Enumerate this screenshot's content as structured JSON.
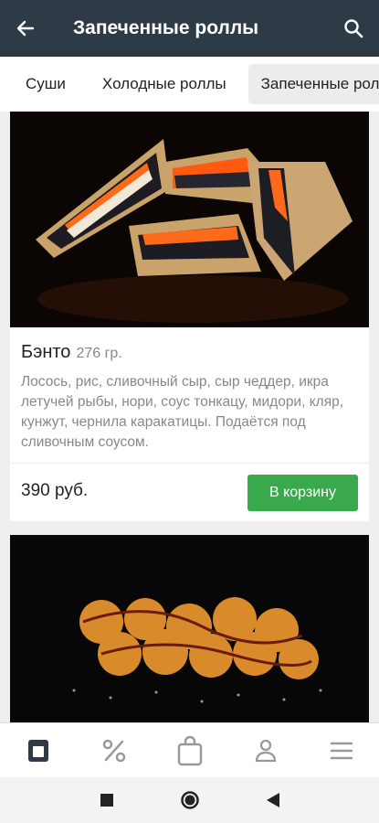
{
  "header": {
    "title": "Запеченные роллы",
    "back_icon": "arrow-left-icon",
    "search_icon": "search-icon"
  },
  "tabs": [
    {
      "label": "Суши",
      "active": false
    },
    {
      "label": "Холодные роллы",
      "active": false
    },
    {
      "label": "Запеченные роллы",
      "active": true
    }
  ],
  "products": [
    {
      "name": "Бэнто",
      "weight": "276 гр.",
      "description": "Лосось, рис, сливочный сыр, сыр чеддер, икра летучей рыбы, нори, соус тонкацу, мидори, кляр, кунжут, чернила каракатицы. Подаётся под сливочным соусом.",
      "price": "390 руб.",
      "button_label": "В корзину"
    }
  ],
  "bottom_nav": [
    "menu-icon",
    "discount-icon",
    "cart-icon",
    "profile-icon",
    "more-icon"
  ],
  "colors": {
    "header_bg": "#2e3b47",
    "button_green": "#3aa94b"
  }
}
